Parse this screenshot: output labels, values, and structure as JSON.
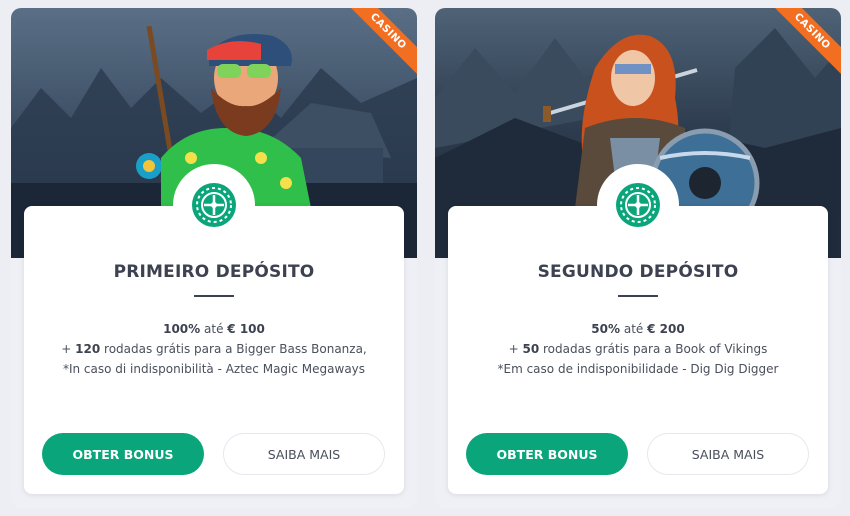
{
  "colors": {
    "accent": "#0aa57a",
    "ribbon": "#f26f21",
    "title": "#3d4250"
  },
  "cards": [
    {
      "badge": "CASINO",
      "title": "PRIMEIRO DEPÓSITO",
      "offer": {
        "percent": "100%",
        "until": "até",
        "amount": "€ 100"
      },
      "spins": {
        "prefix": "+",
        "count": "120",
        "text": "rodadas grátis para a Bigger Bass Bonanza,"
      },
      "note": "*In caso di indisponibilità - Aztec Magic Megaways",
      "primary_button": "OBTER BONUS",
      "secondary_button": "SAIBA MAIS",
      "emblem_icon": "roulette-icon"
    },
    {
      "badge": "CASINO",
      "title": "SEGUNDO DEPÓSITO",
      "offer": {
        "percent": "50%",
        "until": "até",
        "amount": "€ 200"
      },
      "spins": {
        "prefix": "+",
        "count": "50",
        "text": "rodadas grátis para a Book of Vikings"
      },
      "note": "*Em caso de indisponibilidade -  Dig Dig Digger",
      "primary_button": "OBTER BONUS",
      "secondary_button": "SAIBA MAIS",
      "emblem_icon": "roulette-icon"
    }
  ]
}
